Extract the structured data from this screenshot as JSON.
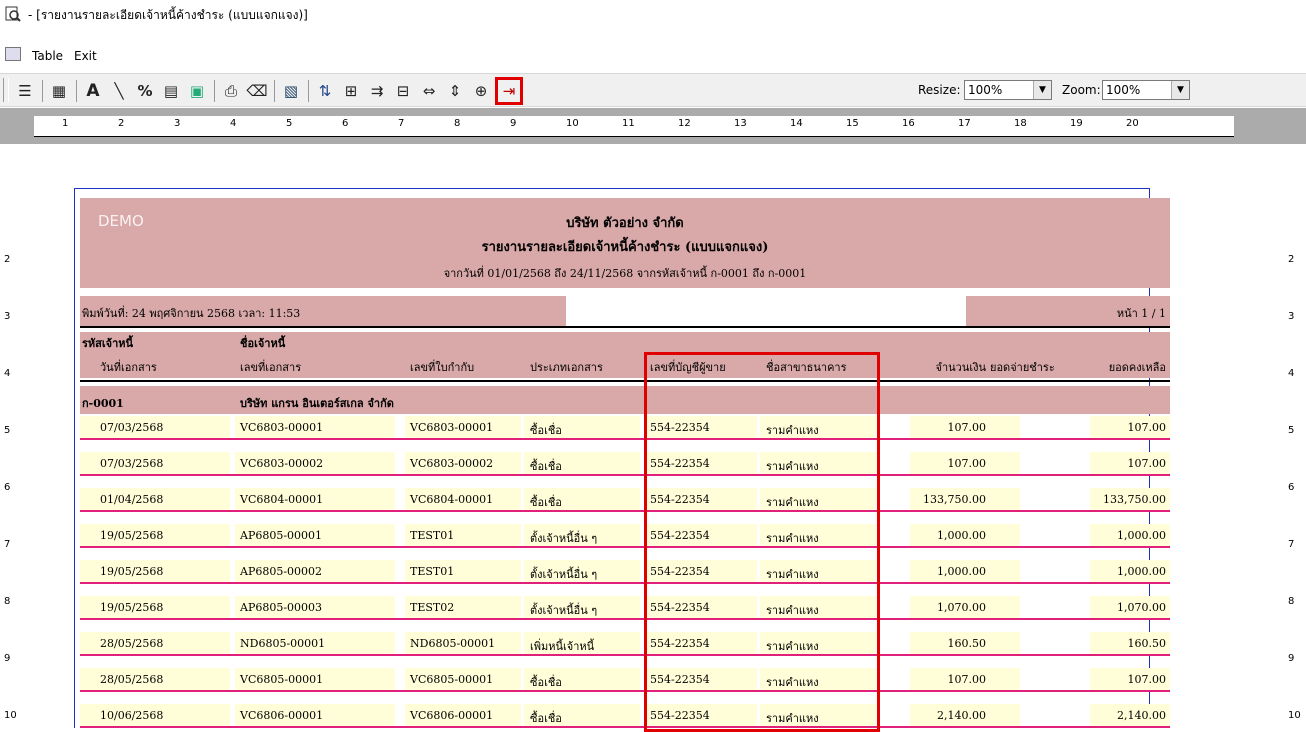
{
  "window": {
    "title": "- [รายงานรายละเอียดเจ้าหนี้ค้างชำระ (แบบแจกแจง)]"
  },
  "menu": {
    "items": [
      "Table",
      "Exit"
    ]
  },
  "toolbar": {
    "resize_label": "Resize:",
    "resize_value": "100%",
    "zoom_label": "Zoom:",
    "zoom_value": "100%",
    "icons": [
      "page-setup-icon",
      "table-icon",
      "font-icon",
      "line-icon",
      "percent-icon",
      "grid-format-icon",
      "image-icon",
      "preview-icon",
      "eraser-icon",
      "export-icon",
      "sort-icon",
      "group-icon",
      "filter-icon",
      "layout-icon",
      "fit-width-icon",
      "fit-height-icon",
      "fit-page-icon",
      "exit-icon"
    ]
  },
  "ruler": {
    "top": [
      "1",
      "2",
      "3",
      "4",
      "5",
      "6",
      "7",
      "8",
      "9",
      "10",
      "11",
      "12",
      "13",
      "14",
      "15",
      "16",
      "17",
      "18",
      "19",
      "20"
    ],
    "left": [
      "2",
      "3",
      "4",
      "5",
      "6",
      "7",
      "8",
      "9",
      "10"
    ]
  },
  "report": {
    "watermark": "DEMO",
    "company": "บริษัท ตัวอย่าง จำกัด",
    "title": "รายงานรายละเอียดเจ้าหนี้ค้างชำระ (แบบแจกแจง)",
    "range": "จากวันที่ 01/01/2568 ถึง 24/11/2568 จากรหัสเจ้าหนี้ ก-0001 ถึง ก-0001",
    "print_date": "พิมพ์วันที่: 24 พฤศจิกายน 2568 เวลา: 11:53",
    "page": "หน้า 1 / 1",
    "header1": [
      "รหัสเจ้าหนี้",
      "ชื่อเจ้าหนี้"
    ],
    "header2": [
      "วันที่เอกสาร",
      "เลขที่เอกสาร",
      "เลขที่ใบกำกับ",
      "ประเภทเอกสาร",
      "เลขที่บัญชีผู้ขาย",
      "ชื่อสาขาธนาคาร",
      "จำนวนเงิน",
      "ยอดจ่ายชำระ",
      "ยอดคงเหลือ"
    ],
    "group": {
      "code": "ก-0001",
      "name": "บริษัท แกรน อินเตอร์สเกล จำกัด"
    },
    "rows": [
      [
        "07/03/2568",
        "VC6803-00001",
        "VC6803-00001",
        "ซื้อเชื่อ",
        "554-22354",
        "รามคำแหง",
        "107.00",
        "107.00"
      ],
      [
        "07/03/2568",
        "VC6803-00002",
        "VC6803-00002",
        "ซื้อเชื่อ",
        "554-22354",
        "รามคำแหง",
        "107.00",
        "107.00"
      ],
      [
        "01/04/2568",
        "VC6804-00001",
        "VC6804-00001",
        "ซื้อเชื่อ",
        "554-22354",
        "รามคำแหง",
        "133,750.00",
        "133,750.00"
      ],
      [
        "19/05/2568",
        "AP6805-00001",
        "TEST01",
        "ตั้งเจ้าหนี้อื่น ๆ",
        "554-22354",
        "รามคำแหง",
        "1,000.00",
        "1,000.00"
      ],
      [
        "19/05/2568",
        "AP6805-00002",
        "TEST01",
        "ตั้งเจ้าหนี้อื่น ๆ",
        "554-22354",
        "รามคำแหง",
        "1,000.00",
        "1,000.00"
      ],
      [
        "19/05/2568",
        "AP6805-00003",
        "TEST02",
        "ตั้งเจ้าหนี้อื่น ๆ",
        "554-22354",
        "รามคำแหง",
        "1,070.00",
        "1,070.00"
      ],
      [
        "28/05/2568",
        "ND6805-00001",
        "ND6805-00001",
        "เพิ่มหนี้เจ้าหนี้",
        "554-22354",
        "รามคำแหง",
        "160.50",
        "160.50"
      ],
      [
        "28/05/2568",
        "VC6805-00001",
        "VC6805-00001",
        "ซื้อเชื่อ",
        "554-22354",
        "รามคำแหง",
        "107.00",
        "107.00"
      ],
      [
        "10/06/2568",
        "VC6806-00001",
        "VC6806-00001",
        "ซื้อเชื่อ",
        "554-22354",
        "รามคำแหง",
        "2,140.00",
        "2,140.00"
      ]
    ]
  }
}
